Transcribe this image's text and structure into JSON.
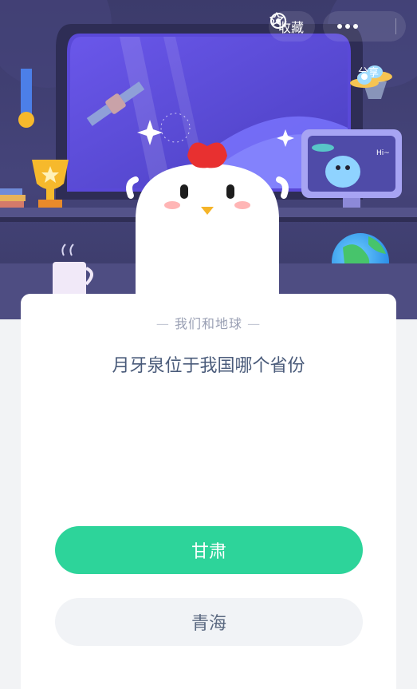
{
  "header": {
    "favorite_label": "收藏",
    "share_label": "分享",
    "favorite_icon": "star-icon",
    "more_icon": "more-dots-icon",
    "close_icon": "target-close-icon"
  },
  "scene": {
    "monitor_text": "Hi~"
  },
  "quiz": {
    "category": "我们和地球",
    "question": "月牙泉位于我国哪个省份",
    "options": [
      {
        "label": "甘肃",
        "state": "selected"
      },
      {
        "label": "青海",
        "state": "default"
      }
    ]
  },
  "colors": {
    "accent_green": "#2dd49a",
    "question_text": "#4a5b7a",
    "scene_bg": "#3c3b6b"
  }
}
